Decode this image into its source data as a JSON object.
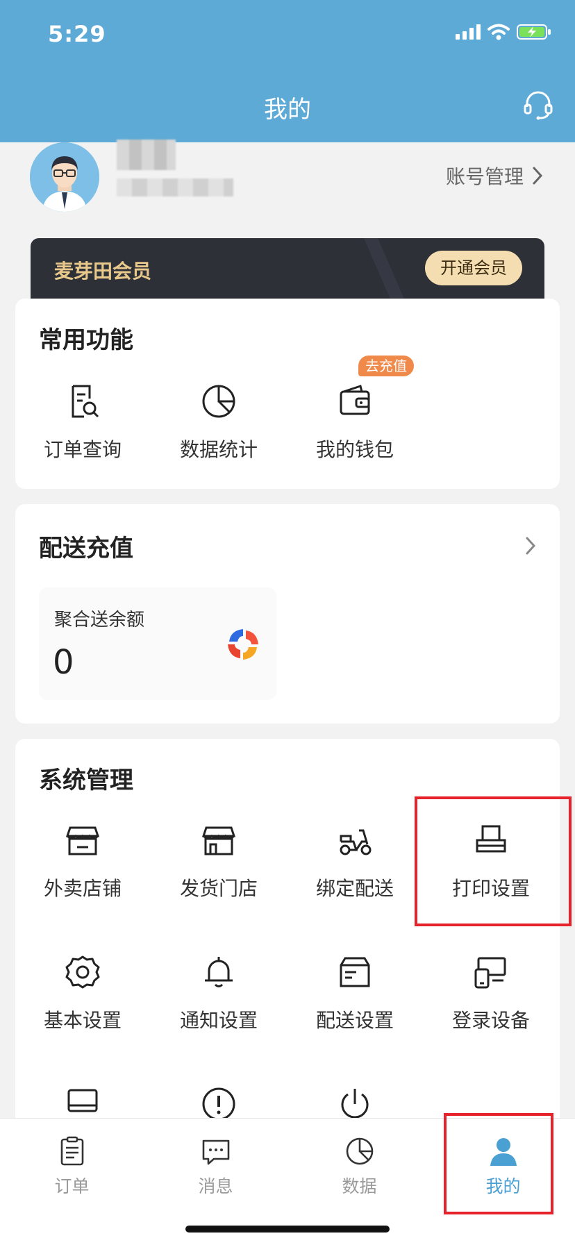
{
  "status_bar": {
    "time": "5:29"
  },
  "header": {
    "title": "我的",
    "support_icon": "headset-icon"
  },
  "profile": {
    "account_mgmt_label": "账号管理"
  },
  "vip": {
    "title": "麦芽田会员",
    "button_label": "开通会员"
  },
  "common_functions": {
    "title": "常用功能",
    "items": [
      {
        "label": "订单查询",
        "icon": "order-search-icon"
      },
      {
        "label": "数据统计",
        "icon": "pie-chart-icon"
      },
      {
        "label": "我的钱包",
        "icon": "wallet-icon",
        "badge": "去充值"
      }
    ]
  },
  "delivery_recharge": {
    "title": "配送充值",
    "balance_label": "聚合送余额",
    "balance_value": "0"
  },
  "system_management": {
    "title": "系统管理",
    "items": [
      {
        "label": "外卖店铺",
        "icon": "storefront-icon"
      },
      {
        "label": "发货门店",
        "icon": "store-icon"
      },
      {
        "label": "绑定配送",
        "icon": "scooter-icon"
      },
      {
        "label": "打印设置",
        "icon": "printer-icon"
      },
      {
        "label": "基本设置",
        "icon": "gear-icon"
      },
      {
        "label": "通知设置",
        "icon": "bell-icon"
      },
      {
        "label": "配送设置",
        "icon": "delivery-box-icon"
      },
      {
        "label": "登录设备",
        "icon": "devices-icon"
      },
      {
        "label": "",
        "icon": "monitor-icon"
      },
      {
        "label": "",
        "icon": "alert-icon"
      },
      {
        "label": "",
        "icon": "power-icon"
      }
    ]
  },
  "bottom_nav": {
    "items": [
      {
        "label": "订单",
        "icon": "clipboard-icon"
      },
      {
        "label": "消息",
        "icon": "message-icon"
      },
      {
        "label": "数据",
        "icon": "pie-chart-icon"
      },
      {
        "label": "我的",
        "icon": "user-icon",
        "active": true
      }
    ]
  },
  "colors": {
    "header": "#5eaad6",
    "active_tab": "#4a9fd3",
    "highlight": "#e6232a",
    "vip_gold": "#e9c98b"
  }
}
